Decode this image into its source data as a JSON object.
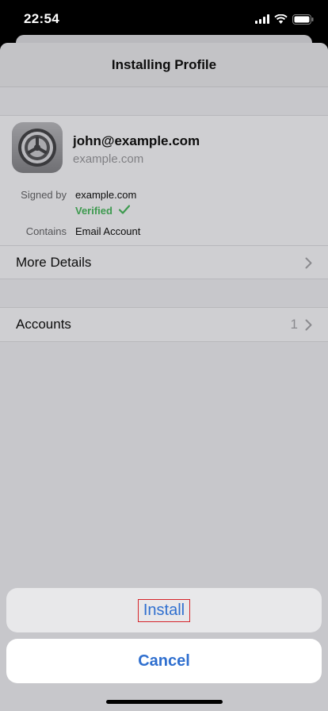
{
  "status_bar": {
    "time": "22:54",
    "icons": [
      "cellular-signal-icon",
      "wifi-icon",
      "battery-icon"
    ]
  },
  "header": {
    "title": "Installing Profile"
  },
  "profile": {
    "icon": "settings-gear-icon",
    "name": "john@example.com",
    "domain": "example.com",
    "signed_by_label": "Signed by",
    "signed_by_value": "example.com",
    "verified_label": "Verified",
    "contains_label": "Contains",
    "contains_value": "Email Account",
    "more_details_label": "More Details"
  },
  "accounts": {
    "label": "Accounts",
    "count": "1"
  },
  "action_sheet": {
    "install_label": "Install",
    "cancel_label": "Cancel"
  },
  "colors": {
    "accent": "#2f6fcf",
    "verified": "#3d9a4f",
    "highlight_box": "#d6252b"
  }
}
